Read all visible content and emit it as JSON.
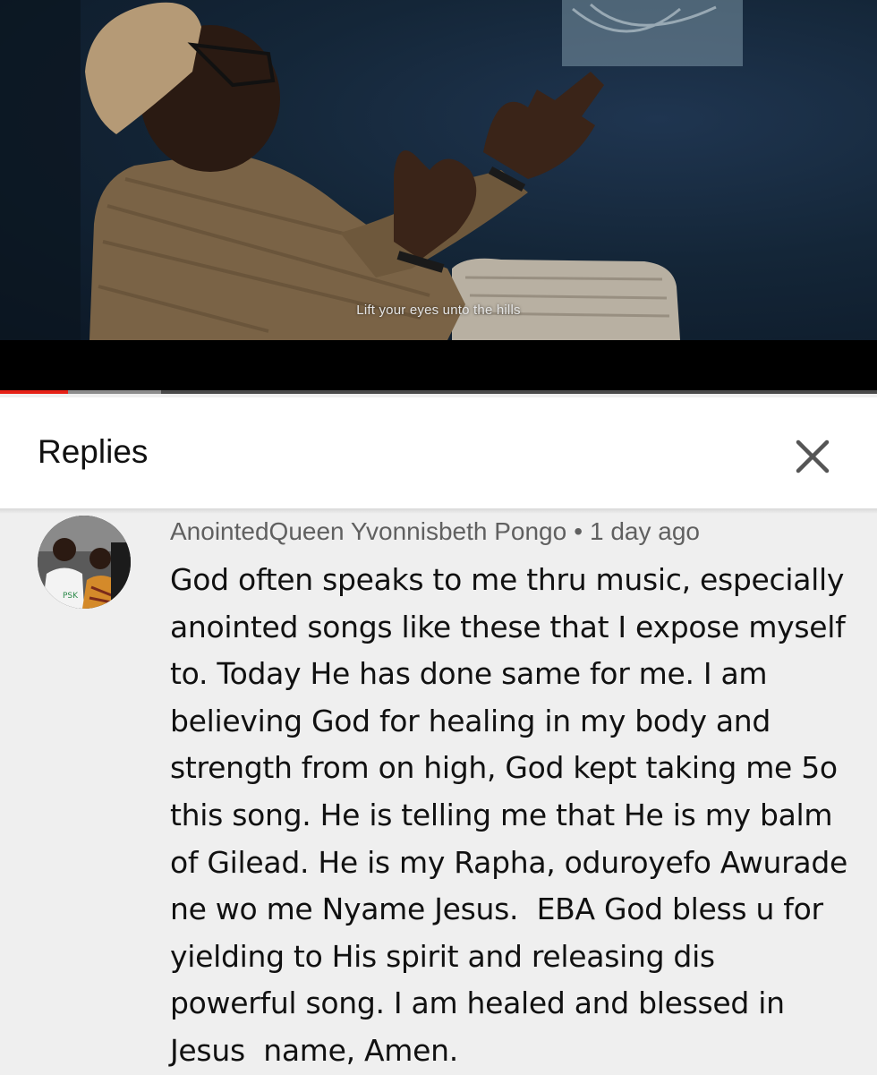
{
  "video": {
    "subtitle": "Lift your eyes unto the hills",
    "progress_fraction": 0.078,
    "buffered_fraction": 0.184
  },
  "replies_panel": {
    "title": "Replies",
    "close_icon": "close-icon"
  },
  "comment": {
    "author": "AnointedQueen Yvonnisbeth Pongo",
    "separator": "•",
    "timestamp": "1 day ago",
    "text": "God often speaks to me thru music, especially anointed songs like these that I expose myself to. Today He has done same for me. I am believing God for healing in my body and strength from on high, God kept taking me 5o this song. He is telling me that He is my balm of Gilead. He is my Rapha, oduroyefo Awurade ne wo me Nyame Jesus.  EBA God bless u for yielding to His spirit and releasing dis powerful song. I am healed and blessed in Jesus  name, Amen."
  },
  "colors": {
    "progress_played": "#e62117",
    "header_background": "#ffffff",
    "page_background": "#efefef",
    "author_text": "#606060"
  }
}
